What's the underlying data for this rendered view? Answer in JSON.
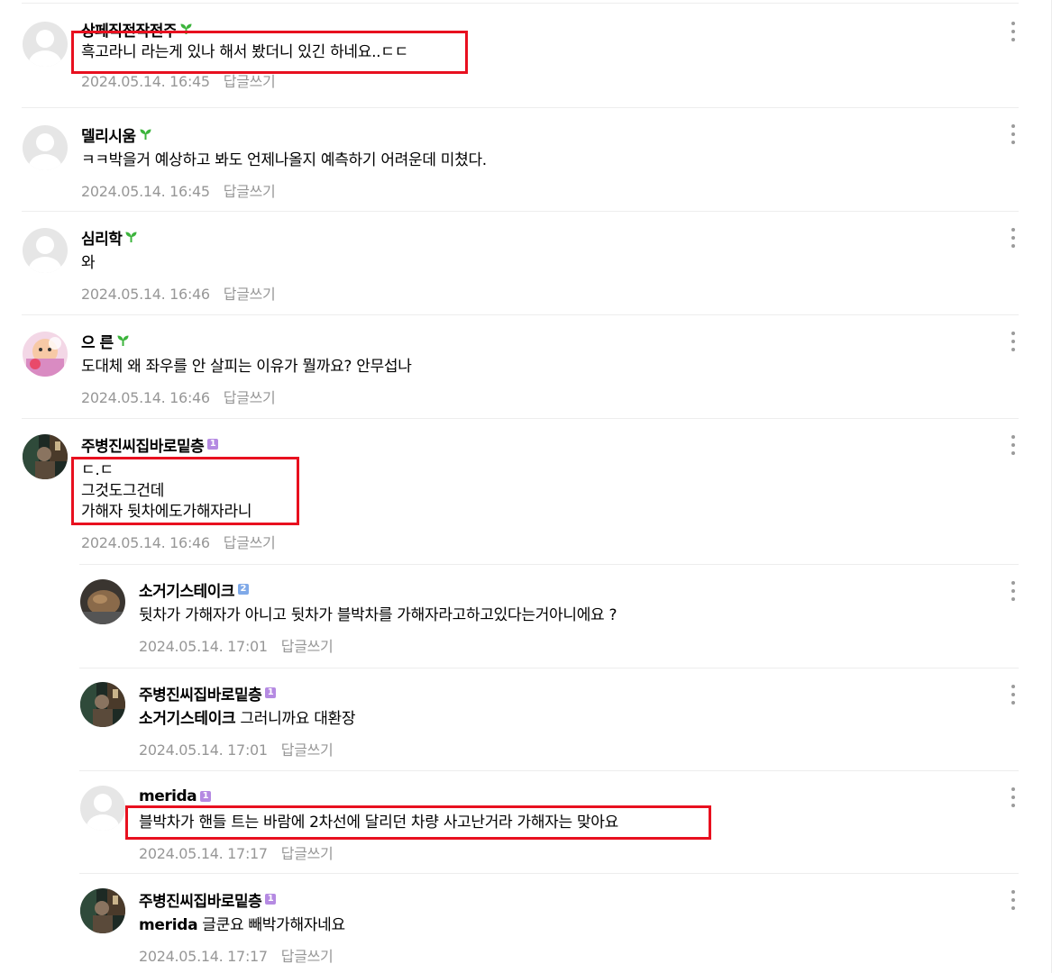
{
  "comments": [
    {
      "author": "상페직전작전주",
      "badge": "sprout",
      "lines": [
        "흑고라니 라는게 있나 해서 봤더니 있긴 하네요..ㄷㄷ"
      ],
      "date": "2024.05.14. 16:45",
      "reply_label": "답글쓰기"
    },
    {
      "author": "델리시움",
      "badge": "sprout",
      "lines": [
        "ㅋㅋ박을거 예상하고 봐도 언제나올지 예측하기 어려운데 미쳤다."
      ],
      "date": "2024.05.14. 16:45",
      "reply_label": "답글쓰기"
    },
    {
      "author": "심리학",
      "badge": "sprout",
      "lines": [
        "와"
      ],
      "date": "2024.05.14. 16:46",
      "reply_label": "답글쓰기"
    },
    {
      "author": "으 른",
      "badge": "sprout",
      "lines": [
        "도대체 왜 좌우를 안 살피는 이유가 뭘까요? 안무섭나"
      ],
      "date": "2024.05.14. 16:46",
      "reply_label": "답글쓰기"
    },
    {
      "author": "주병진씨집바로밑층",
      "badge": "1",
      "lines": [
        "ㄷ.ㄷ",
        "그것도그건데",
        "가해자 뒷차에도가해자라니"
      ],
      "date": "2024.05.14. 16:46",
      "reply_label": "답글쓰기"
    },
    {
      "author": "소거기스테이크",
      "badge": "2",
      "lines": [
        "뒷차가 가해자가 아니고 뒷차가 블박차를 가해자라고하고있다는거아니에요 ?"
      ],
      "date": "2024.05.14. 17:01",
      "reply_label": "답글쓰기"
    },
    {
      "author": "주병진씨집바로밑층",
      "badge": "1",
      "mention": "소거기스테이크",
      "lines": [
        "그러니까요 대환장"
      ],
      "date": "2024.05.14. 17:01",
      "reply_label": "답글쓰기"
    },
    {
      "author": "merida",
      "badge": "1",
      "lines": [
        "블박차가 핸들 트는 바람에 2차선에 달리던 차량 사고난거라 가해자는 맞아요"
      ],
      "date": "2024.05.14. 17:17",
      "reply_label": "답글쓰기"
    },
    {
      "author": "주병진씨집바로밑층",
      "badge": "1",
      "mention": "merida",
      "lines": [
        "글쿤요 빼박가해자네요"
      ],
      "date": "2024.05.14. 17:17",
      "reply_label": "답글쓰기"
    }
  ],
  "colors": {
    "highlight": "#e8101f",
    "sprout": "#3cb43c",
    "badge_level1": "#b58ae2",
    "badge_level2": "#7fa9e8",
    "meta_text": "#979797"
  }
}
